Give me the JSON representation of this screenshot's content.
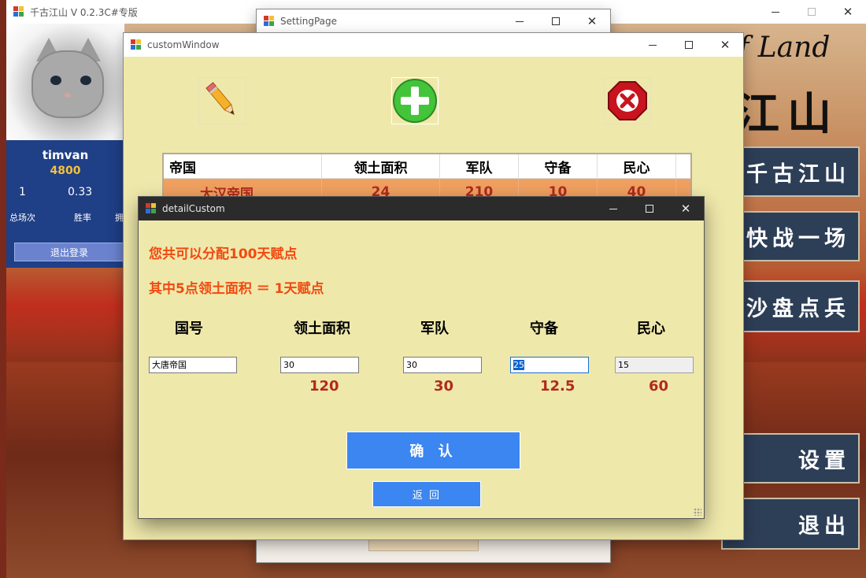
{
  "main_window": {
    "title": "千古江山 V 0.2.3C#专版",
    "logo_en": "f Land",
    "logo_cn": "江山",
    "menu": [
      "千古江山",
      "快战一场",
      "沙盘点兵",
      "设置",
      "退出"
    ],
    "user": {
      "name": "timvan",
      "score": "4800",
      "total_games": "1",
      "win_rate": "0.33",
      "label_total": "总场次",
      "label_win": "胜率",
      "label_third": "拥",
      "logout": "退出登录"
    }
  },
  "setting_page": {
    "title": "SettingPage"
  },
  "custom_window": {
    "title": "customWindow",
    "icons": [
      "pencil-icon",
      "plus-icon",
      "delete-icon"
    ],
    "grid": {
      "columns": [
        "帝国",
        "领土面积",
        "军队",
        "守备",
        "民心"
      ],
      "rows": [
        [
          "大汉帝国",
          "24",
          "210",
          "10",
          "40"
        ]
      ]
    }
  },
  "detail_dialog": {
    "title": "detailCustom",
    "line1": "您共可以分配100天赋点",
    "line2": "其中5点领土面积 ＝ 1天赋点",
    "headers": [
      "国号",
      "领土面积",
      "军队",
      "守备",
      "民心"
    ],
    "inputs": {
      "country": "大唐帝国",
      "territory": "30",
      "army": "30",
      "defense": "25",
      "morale": "15"
    },
    "computed": [
      "120",
      "30",
      "12.5",
      "60"
    ],
    "confirm": "确 认",
    "back": "返 回"
  }
}
